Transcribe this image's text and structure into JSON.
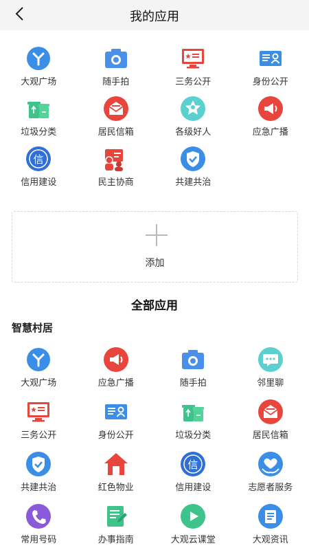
{
  "header": {
    "title": "我的应用",
    "back_icon": "chevron-left-icon"
  },
  "my_apps": [
    {
      "label": "大观广场",
      "icon": "guangchang"
    },
    {
      "label": "随手拍",
      "icon": "camera"
    },
    {
      "label": "三务公开",
      "icon": "sanwu"
    },
    {
      "label": "身份公开",
      "icon": "idcard"
    },
    {
      "label": "垃圾分类",
      "icon": "trash"
    },
    {
      "label": "居民信箱",
      "icon": "mail"
    },
    {
      "label": "各级好人",
      "icon": "goodman"
    },
    {
      "label": "应急广播",
      "icon": "broadcast"
    },
    {
      "label": "信用建设",
      "icon": "credit"
    },
    {
      "label": "民主协商",
      "icon": "democracy"
    },
    {
      "label": "共建共治",
      "icon": "shield"
    }
  ],
  "add": {
    "label": "添加"
  },
  "all_apps": {
    "title": "全部应用",
    "group_title": "智慧村居",
    "items": [
      {
        "label": "大观广场",
        "icon": "guangchang"
      },
      {
        "label": "应急广播",
        "icon": "broadcast"
      },
      {
        "label": "随手拍",
        "icon": "camera"
      },
      {
        "label": "邻里聊",
        "icon": "chat"
      },
      {
        "label": "三务公开",
        "icon": "sanwu"
      },
      {
        "label": "身份公开",
        "icon": "idcard"
      },
      {
        "label": "垃圾分类",
        "icon": "trash"
      },
      {
        "label": "居民信箱",
        "icon": "mail"
      },
      {
        "label": "共建共治",
        "icon": "shield"
      },
      {
        "label": "红色物业",
        "icon": "house"
      },
      {
        "label": "信用建设",
        "icon": "credit"
      },
      {
        "label": "志愿者服务",
        "icon": "volunteer"
      },
      {
        "label": "常用号码",
        "icon": "phone"
      },
      {
        "label": "办事指南",
        "icon": "guide"
      },
      {
        "label": "大观云课堂",
        "icon": "video"
      },
      {
        "label": "大观资讯",
        "icon": "news"
      }
    ]
  },
  "colors": {
    "header_bg": "#f4f4f4",
    "blue": "#3a8ee6",
    "red": "#e8453c",
    "green": "#3ec48a",
    "teal": "#5ccfcf",
    "purple": "#8a5ad8",
    "dashed_border": "#d6d6d6"
  }
}
